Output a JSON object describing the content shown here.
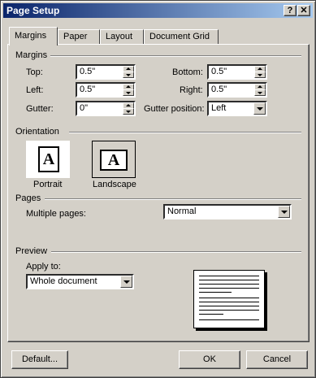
{
  "window": {
    "title": "Page Setup",
    "help_glyph": "?",
    "close_glyph": "✕"
  },
  "tabs": [
    {
      "label": "Margins",
      "active": true
    },
    {
      "label": "Paper",
      "active": false
    },
    {
      "label": "Layout",
      "active": false
    },
    {
      "label": "Document Grid",
      "active": false
    }
  ],
  "margins": {
    "group_title": "Margins",
    "top": {
      "label": "Top:",
      "value": "0.5\""
    },
    "left": {
      "label": "Left:",
      "value": "0.5\""
    },
    "gutter": {
      "label": "Gutter:",
      "value": "0\""
    },
    "bottom": {
      "label": "Bottom:",
      "value": "0.5\""
    },
    "right": {
      "label": "Right:",
      "value": "0.5\""
    },
    "gutter_position": {
      "label": "Gutter position:",
      "value": "Left"
    }
  },
  "orientation": {
    "group_title": "Orientation",
    "portrait_label": "Portrait",
    "landscape_label": "Landscape",
    "icon_letter": "A",
    "selected": "Landscape"
  },
  "pages": {
    "group_title": "Pages",
    "multiple_pages_label": "Multiple pages:",
    "multiple_pages_value": "Normal"
  },
  "preview": {
    "group_title": "Preview",
    "apply_to_label": "Apply to:",
    "apply_to_value": "Whole document"
  },
  "buttons": {
    "default": "Default...",
    "ok": "OK",
    "cancel": "Cancel"
  }
}
